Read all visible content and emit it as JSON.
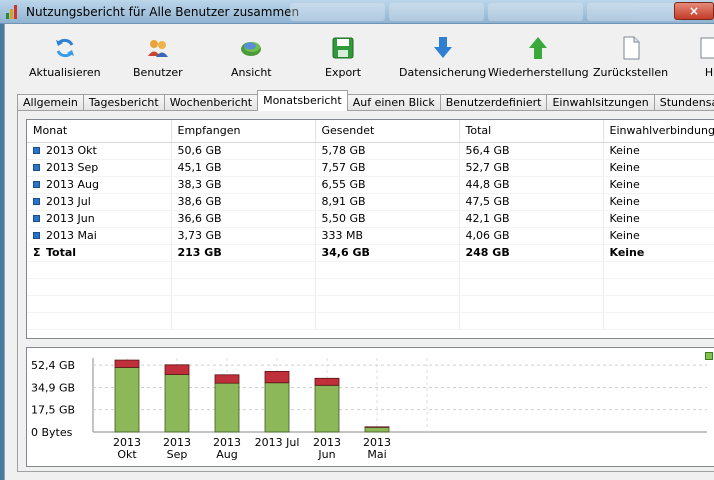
{
  "window": {
    "title": "Nutzungsbericht für Alle Benutzer zusammen",
    "close": "×"
  },
  "toolbar": [
    {
      "label": "Aktualisieren",
      "icon": "refresh-icon"
    },
    {
      "label": "Benutzer",
      "icon": "users-icon"
    },
    {
      "label": "Ansicht",
      "icon": "view-icon"
    },
    {
      "label": "Export",
      "icon": "save-icon"
    },
    {
      "label": "Datensicherung",
      "icon": "arrow-down-icon"
    },
    {
      "label": "Wiederherstellung",
      "icon": "arrow-up-icon"
    },
    {
      "label": "Zurückstellen",
      "icon": "document-icon"
    },
    {
      "label": "H",
      "icon": "help-icon"
    }
  ],
  "tabs": [
    "Allgemein",
    "Tagesbericht",
    "Wochenbericht",
    "Monatsbericht",
    "Auf einen Blick",
    "Benutzerdefiniert",
    "Einwahlsitzungen",
    "Stundensatz"
  ],
  "active_tab": "Monatsbericht",
  "table": {
    "columns": [
      "Monat",
      "Empfangen",
      "Gesendet",
      "Total",
      "Einwahlverbindung"
    ],
    "rows": [
      [
        "2013 Okt",
        "50,6 GB",
        "5,78 GB",
        "56,4 GB",
        "Keine"
      ],
      [
        "2013 Sep",
        "45,1 GB",
        "7,57 GB",
        "52,7 GB",
        "Keine"
      ],
      [
        "2013 Aug",
        "38,3 GB",
        "6,55 GB",
        "44,8 GB",
        "Keine"
      ],
      [
        "2013 Jul",
        "38,6 GB",
        "8,91 GB",
        "47,5 GB",
        "Keine"
      ],
      [
        "2013 Jun",
        "36,6 GB",
        "5,50 GB",
        "42,1 GB",
        "Keine"
      ],
      [
        "2013 Mai",
        "3,73 GB",
        "333 MB",
        "4,06 GB",
        "Keine"
      ]
    ],
    "total": [
      "Total",
      "213 GB",
      "34,6 GB",
      "248 GB",
      "Keine"
    ]
  },
  "chart_data": {
    "type": "bar",
    "stacked": true,
    "categories": [
      [
        "2013",
        "Okt"
      ],
      [
        "2013",
        "Sep"
      ],
      [
        "2013",
        "Aug"
      ],
      [
        "2013 Jul"
      ],
      [
        "2013",
        "Jun"
      ],
      [
        "2013",
        "Mai"
      ]
    ],
    "series": [
      {
        "values": [
          50.6,
          45.1,
          38.3,
          38.6,
          36.6,
          3.73
        ],
        "color": "#8db85a"
      },
      {
        "values": [
          5.78,
          7.57,
          6.55,
          8.91,
          5.5,
          0.333
        ],
        "color": "#c0303a"
      }
    ],
    "y_ticks": [
      "52,4 GB",
      "34,9 GB",
      "17,5 GB",
      "0 Bytes"
    ],
    "y_tick_values": [
      52.4,
      34.9,
      17.5,
      0
    ],
    "ylim": [
      0,
      58
    ],
    "grid": true
  }
}
